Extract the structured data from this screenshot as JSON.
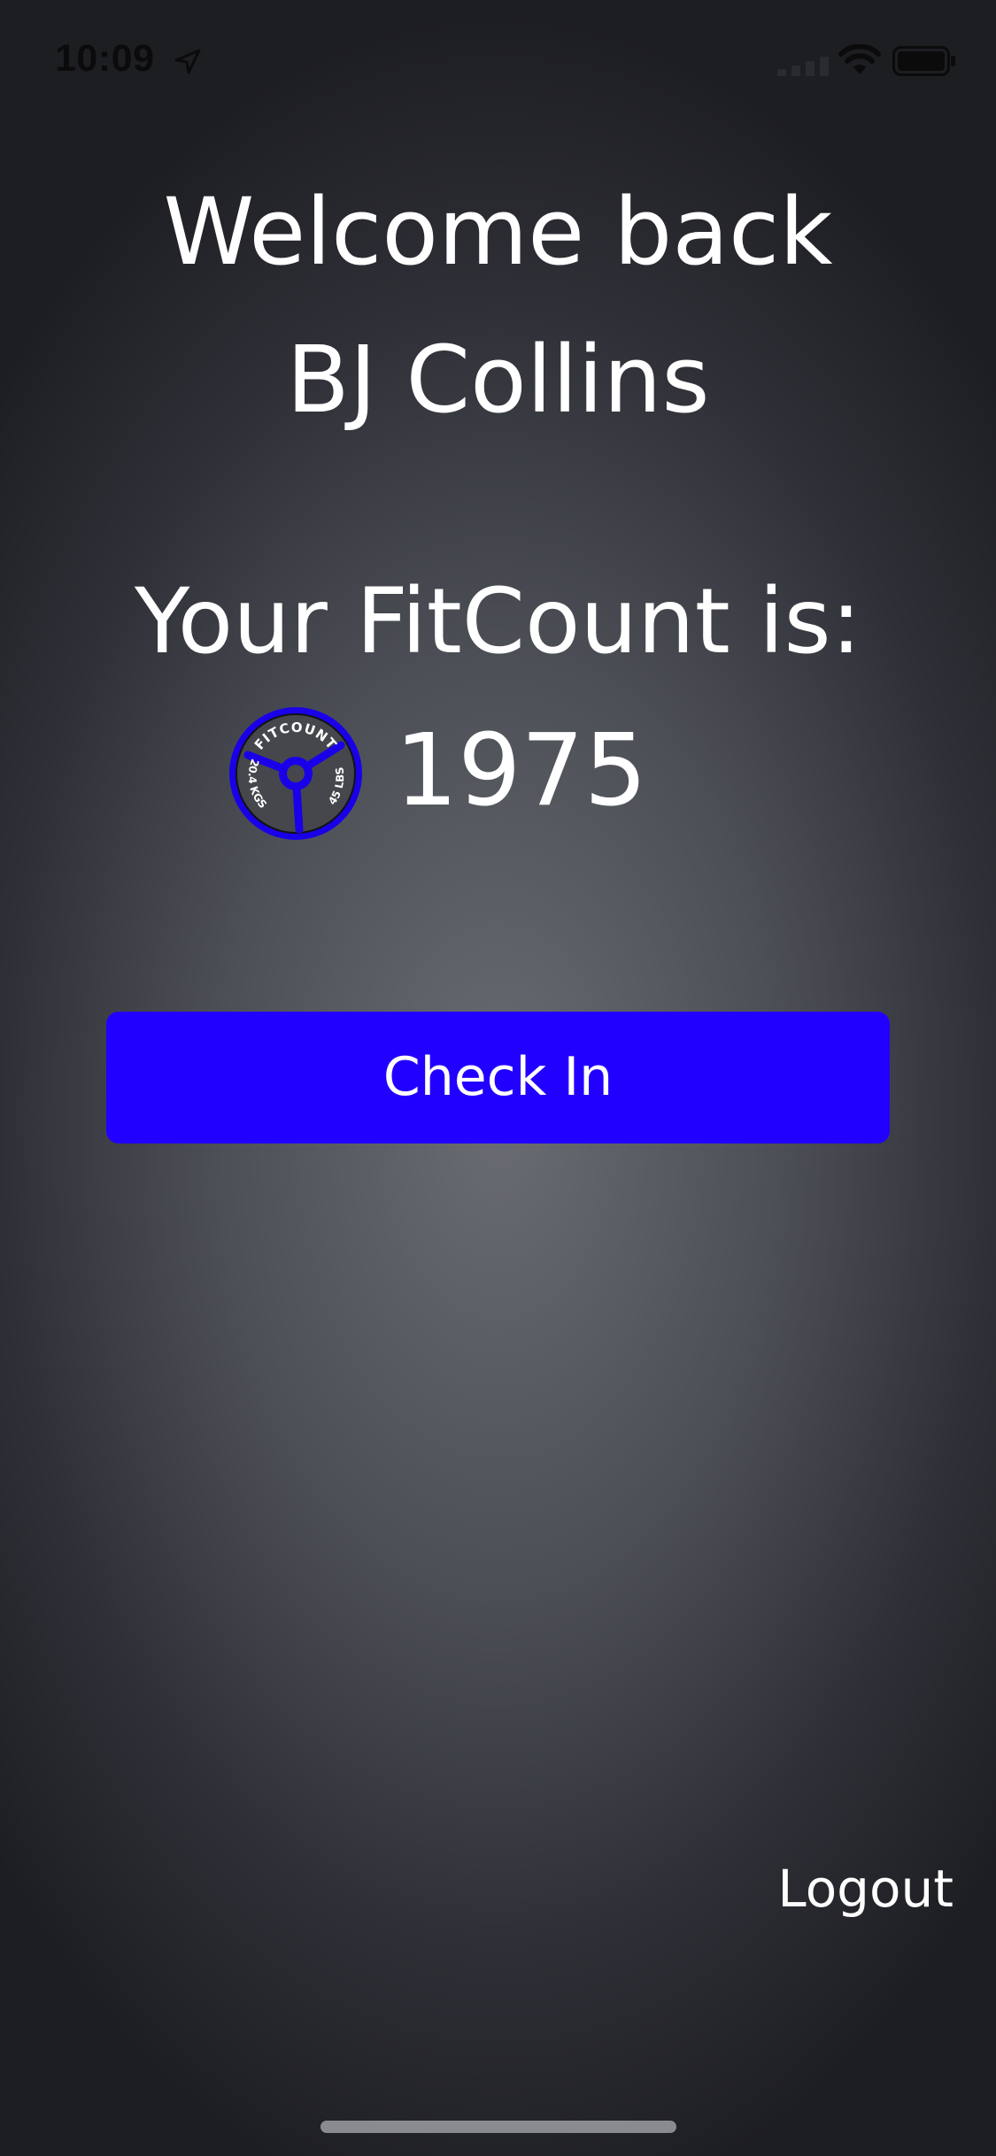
{
  "status_bar": {
    "time": "10:09",
    "location_icon": "location-arrow-icon",
    "signal_icon": "cellular-signal-icon",
    "wifi_icon": "wifi-icon",
    "battery_icon": "battery-icon"
  },
  "greeting": {
    "welcome": "Welcome back",
    "name": "BJ Collins"
  },
  "fitcount": {
    "label": "Your FitCount is:",
    "value": "1975",
    "plate_top_text": "FITCOUNT",
    "plate_left_text": "20.4 KGS",
    "plate_right_text": "45 LBS",
    "plate_icon": "weight-plate-icon"
  },
  "actions": {
    "check_in": "Check In",
    "logout": "Logout"
  },
  "colors": {
    "accent": "#2200ff",
    "plate_ring": "#1a00e8",
    "plate_body": "#4a4b50",
    "text": "#ffffff"
  }
}
